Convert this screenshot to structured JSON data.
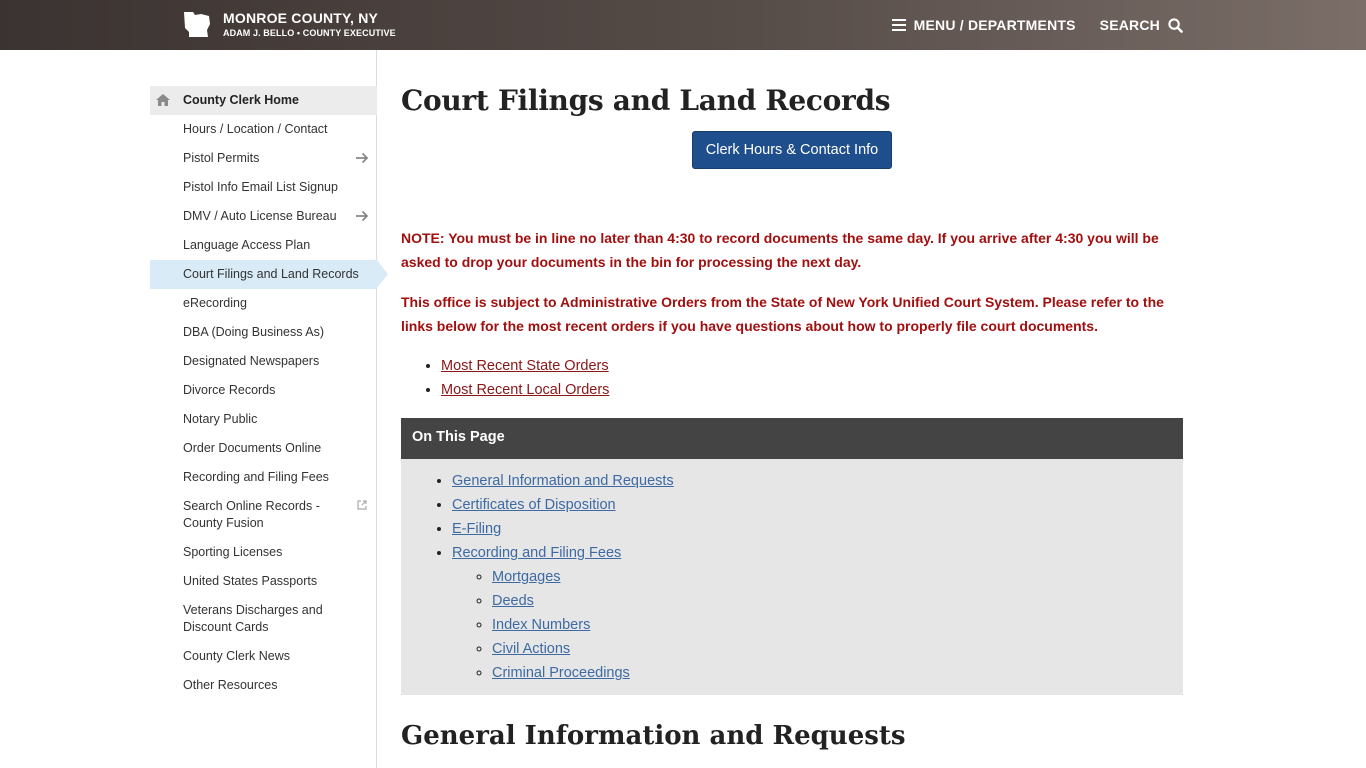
{
  "header": {
    "site_name": "MONROE COUNTY, NY",
    "site_sub": "ADAM J. BELLO • COUNTY EXECUTIVE",
    "menu_label": "MENU / DEPARTMENTS",
    "search_label": "SEARCH"
  },
  "sidebar": {
    "items": [
      {
        "label": "County Clerk Home"
      },
      {
        "label": "Hours / Location / Contact"
      },
      {
        "label": "Pistol Permits"
      },
      {
        "label": "Pistol Info Email List Signup"
      },
      {
        "label": "DMV / Auto License Bureau"
      },
      {
        "label": "Language Access Plan"
      },
      {
        "label": "Court Filings and Land Records"
      },
      {
        "label": "eRecording"
      },
      {
        "label": "DBA (Doing Business As)"
      },
      {
        "label": "Designated Newspapers"
      },
      {
        "label": "Divorce Records"
      },
      {
        "label": "Notary Public"
      },
      {
        "label": "Order Documents Online"
      },
      {
        "label": "Recording and Filing Fees"
      },
      {
        "label": "Search Online Records - County Fusion"
      },
      {
        "label": "Sporting Licenses"
      },
      {
        "label": "United States Passports"
      },
      {
        "label": "Veterans Discharges and Discount Cards"
      },
      {
        "label": "County Clerk News"
      },
      {
        "label": "Other Resources"
      }
    ]
  },
  "main": {
    "title": "Court Filings and Land Records",
    "button_label": "Clerk Hours & Contact Info",
    "notice1": "NOTE: You must be in line no later than 4:30 to record documents the same day.  If you arrive after 4:30 you will be asked to drop your documents in the bin for processing the next day.",
    "notice2": "This office is subject to Administrative Orders from the State of New York Unified Court System.  Please refer to the links below for the most recent orders if you have questions about how to properly file court documents.",
    "orders": [
      "Most Recent State Orders",
      "Most Recent Local Orders"
    ],
    "toc": {
      "heading": "On This Page",
      "items": [
        "General Information and Requests",
        "Certificates of Disposition",
        "E-Filing",
        "Recording and Filing Fees"
      ],
      "subitems": [
        "Mortgages",
        "Deeds",
        "Index Numbers",
        "Civil Actions",
        "Criminal Proceedings"
      ]
    },
    "next_heading": "General Information and Requests"
  },
  "colors": {
    "header_bg": "#4a403d",
    "button_bg": "#1f4e8c",
    "notice_text": "#a20f0f",
    "toc_header_bg": "#444444",
    "toc_body_bg": "#e6e6e6",
    "active_item_bg": "#d8ebf7"
  }
}
